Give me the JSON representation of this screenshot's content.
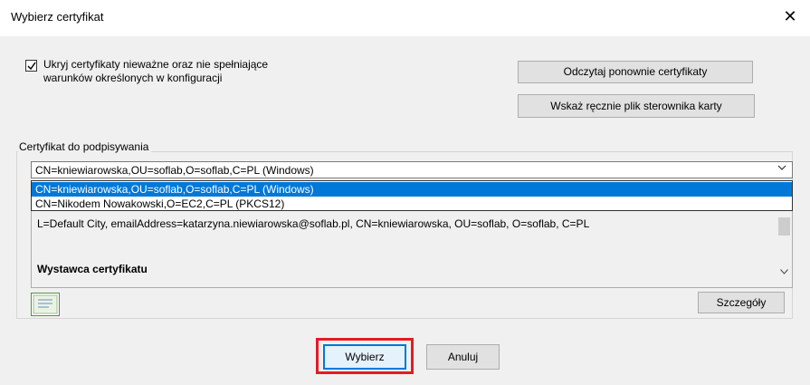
{
  "window": {
    "title": "Wybierz certyfikat",
    "close_glyph": "✕"
  },
  "options": {
    "hide_invalid_label": "Ukryj certyfikaty nieważne oraz nie spełniające warunków określonych w konfiguracji",
    "hide_invalid_checked": true,
    "reload_label": "Odczytaj ponownie certyfikaty",
    "driver_label": "Wskaż ręcznie plik sterownika karty"
  },
  "certificate": {
    "group_label": "Certyfikat do podpisywania",
    "selected_value": "CN=kniewiarowska,OU=soflab,O=soflab,C=PL (Windows)",
    "dropdown_items": [
      "CN=kniewiarowska,OU=soflab,O=soflab,C=PL (Windows)",
      "CN=Nikodem Nowakowski,O=EC2,C=PL (PKCS12)"
    ],
    "subject_text": "L=Default City, emailAddress=katarzyna.niewiarowska@soflab.pl, CN=kniewiarowska, OU=soflab, O=soflab, C=PL",
    "issuer_heading": "Wystawca certyfikatu",
    "issuer_cutoff": "..."
  },
  "actions": {
    "details_label": "Szczegóły",
    "choose_label": "Wybierz",
    "cancel_label": "Anuluj"
  },
  "colors": {
    "selection": "#0078d7",
    "highlight": "#e31b23",
    "dialog_bg": "#f0f0f0"
  }
}
